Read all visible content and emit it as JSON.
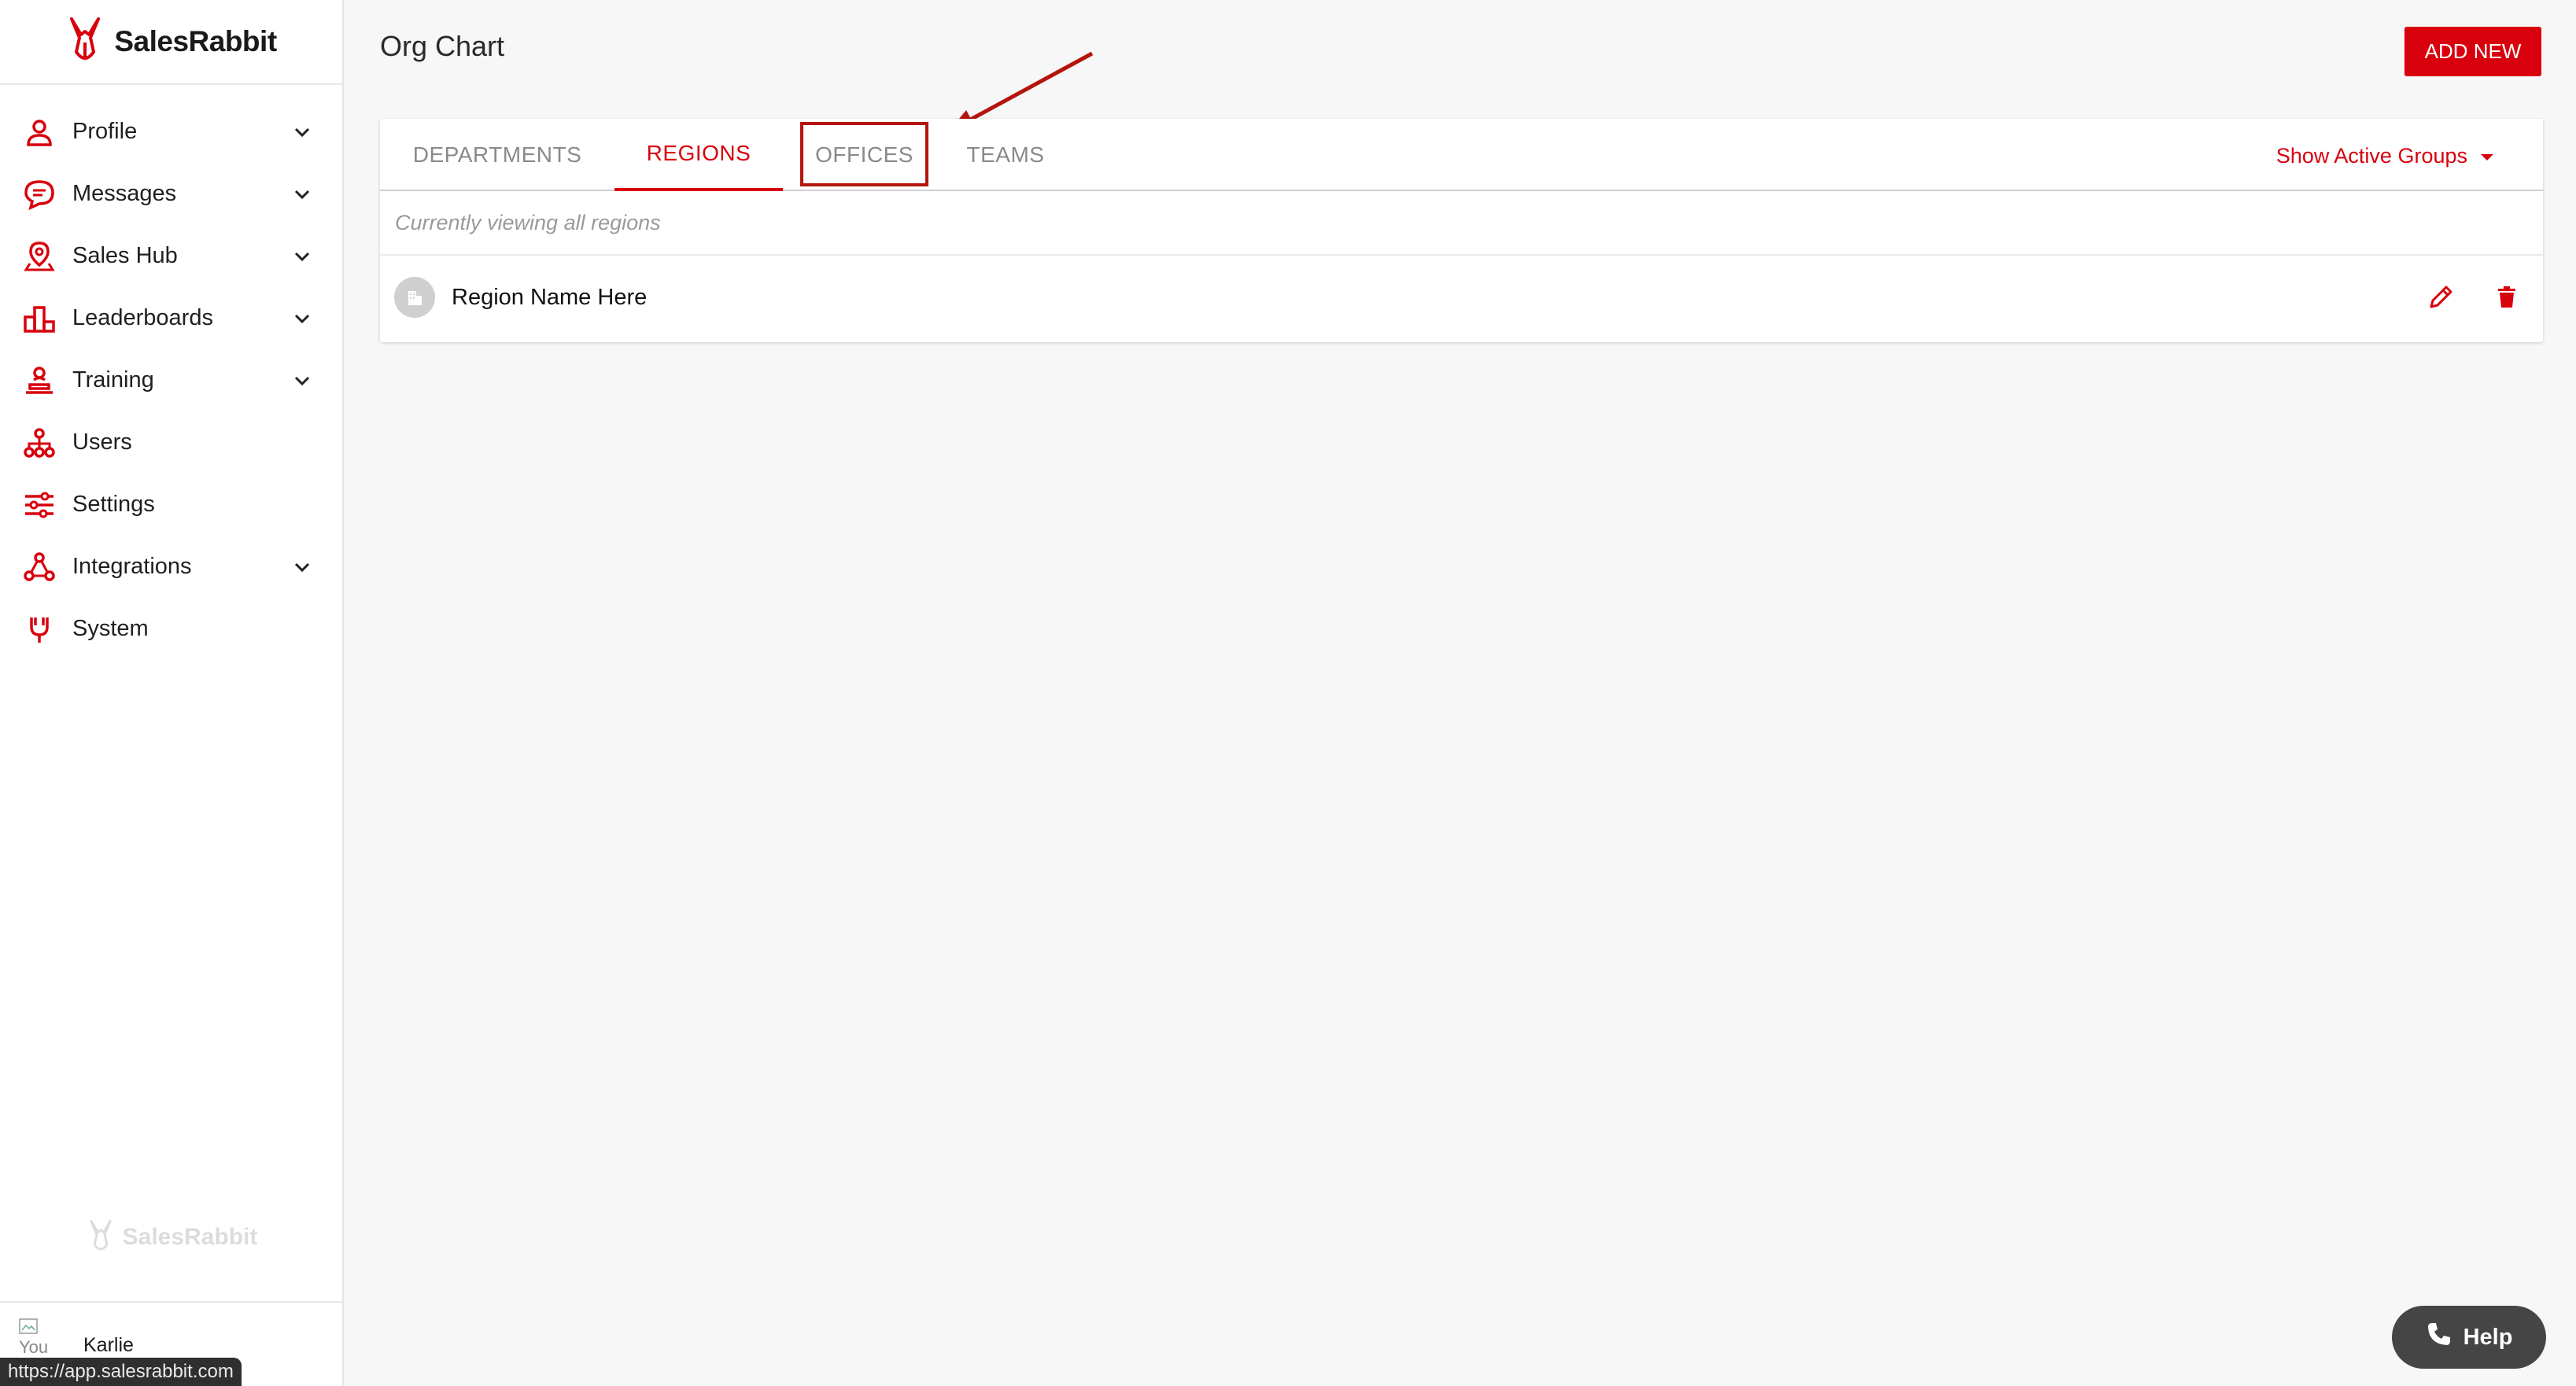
{
  "app": {
    "brand": "SalesRabbit",
    "accent": "#d9000d"
  },
  "sidebar": {
    "items": [
      {
        "label": "Profile",
        "icon": "person-icon",
        "expandable": true
      },
      {
        "label": "Messages",
        "icon": "chat-icon",
        "expandable": true
      },
      {
        "label": "Sales Hub",
        "icon": "map-pin-icon",
        "expandable": true
      },
      {
        "label": "Leaderboards",
        "icon": "podium-icon",
        "expandable": true
      },
      {
        "label": "Training",
        "icon": "training-icon",
        "expandable": true
      },
      {
        "label": "Users",
        "icon": "org-chart-icon",
        "expandable": false
      },
      {
        "label": "Settings",
        "icon": "sliders-icon",
        "expandable": false
      },
      {
        "label": "Integrations",
        "icon": "integrations-icon",
        "expandable": true
      },
      {
        "label": "System",
        "icon": "system-plug-icon",
        "expandable": false
      }
    ],
    "footer_brand": "SalesRabbit",
    "user": {
      "name": "Karlie",
      "avatar_alt": "You"
    }
  },
  "status_url": "https://app.salesrabbit.com",
  "main": {
    "title": "Org Chart",
    "add_button": "ADD NEW",
    "tabs": [
      {
        "label": "DEPARTMENTS",
        "active": false
      },
      {
        "label": "REGIONS",
        "active": true
      },
      {
        "label": "OFFICES",
        "active": false,
        "highlighted": true
      },
      {
        "label": "TEAMS",
        "active": false
      }
    ],
    "filter_label": "Show Active Groups",
    "viewing_text": "Currently viewing all regions",
    "rows": [
      {
        "name": "Region Name Here"
      }
    ]
  },
  "help_button": "Help"
}
